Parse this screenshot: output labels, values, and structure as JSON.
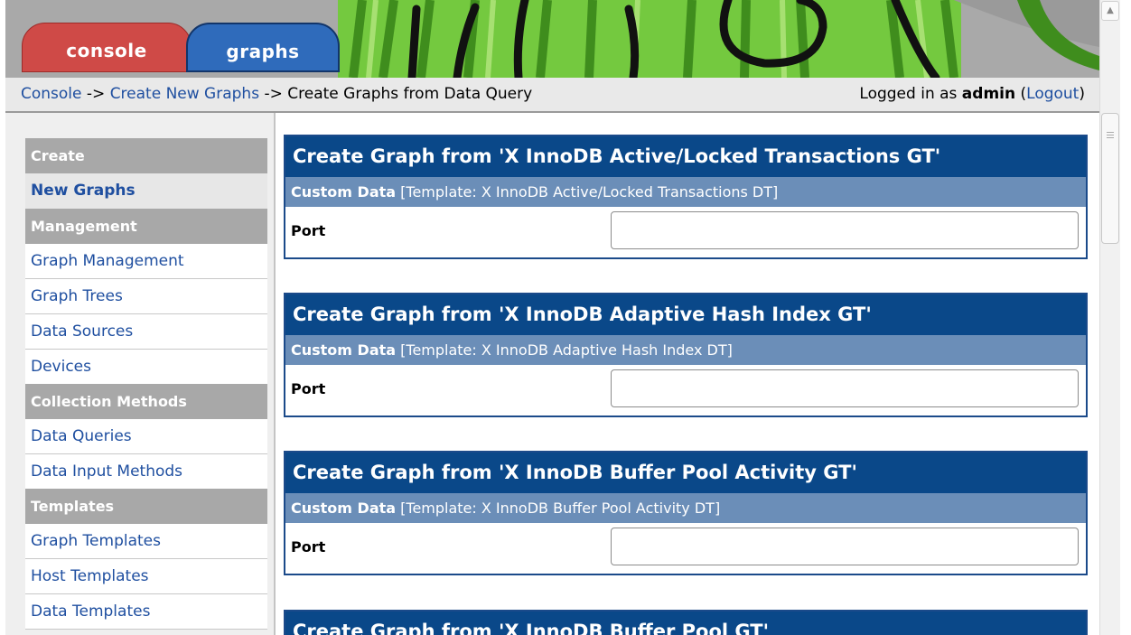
{
  "tabs": {
    "console": "console",
    "graphs": "graphs"
  },
  "breadcrumb": {
    "console": "Console",
    "sep1": " -> ",
    "create_new_graphs": "Create New Graphs",
    "sep2": " -> ",
    "current": "Create Graphs from Data Query"
  },
  "login": {
    "prefix": "Logged in as ",
    "user": "admin",
    "open": " (",
    "logout": "Logout",
    "close": ")"
  },
  "menu": {
    "create": "Create",
    "new_graphs": "New Graphs",
    "management": "Management",
    "graph_management": "Graph Management",
    "graph_trees": "Graph Trees",
    "data_sources": "Data Sources",
    "devices": "Devices",
    "collection_methods": "Collection Methods",
    "data_queries": "Data Queries",
    "data_input_methods": "Data Input Methods",
    "templates": "Templates",
    "graph_templates": "Graph Templates",
    "host_templates": "Host Templates",
    "data_templates": "Data Templates"
  },
  "cards": [
    {
      "title": "Create Graph from 'X InnoDB Active/Locked Transactions GT'",
      "sub_label": "Custom Data",
      "sub_template": " [Template: X InnoDB Active/Locked Transactions DT]",
      "field_label": "Port",
      "field_value": ""
    },
    {
      "title": "Create Graph from 'X InnoDB Adaptive Hash Index GT'",
      "sub_label": "Custom Data",
      "sub_template": " [Template: X InnoDB Adaptive Hash Index DT]",
      "field_label": "Port",
      "field_value": ""
    },
    {
      "title": "Create Graph from 'X InnoDB Buffer Pool Activity GT'",
      "sub_label": "Custom Data",
      "sub_template": " [Template: X InnoDB Buffer Pool Activity DT]",
      "field_label": "Port",
      "field_value": ""
    },
    {
      "title": "Create Graph from 'X InnoDB Buffer Pool GT'"
    }
  ],
  "colors": {
    "title_bar": "#0a4889",
    "sub_bar": "#6b8eb8",
    "link": "#1f4fa0",
    "menu_header": "#a8a8a8",
    "tab_console": "#cf4a47",
    "tab_graphs": "#2f6bbb",
    "banner_green": "#6fcb3c"
  }
}
